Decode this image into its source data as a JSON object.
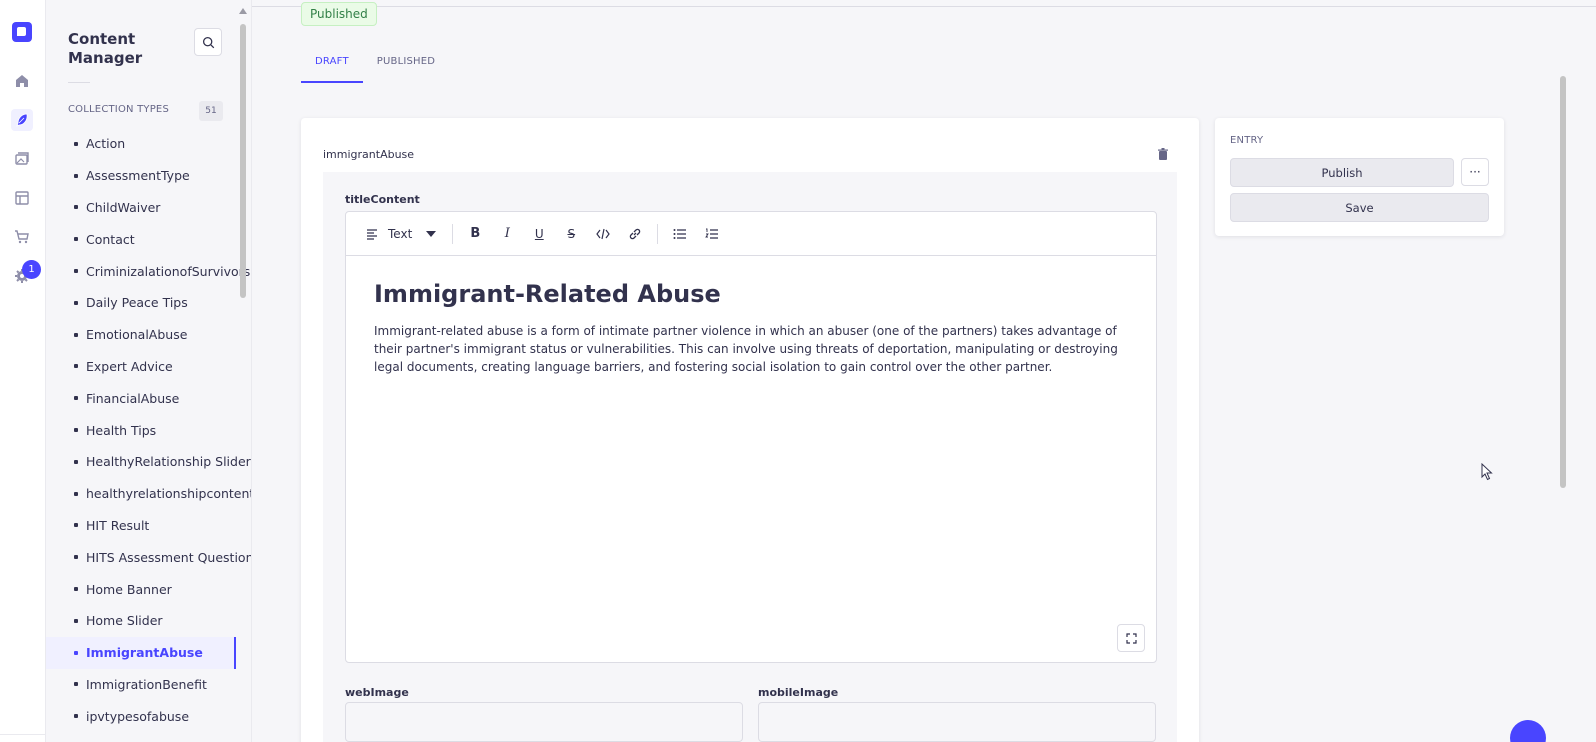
{
  "rail": {
    "notification_count": "1"
  },
  "subnav": {
    "title": "Content Manager",
    "section_title": "COLLECTION TYPES",
    "count": "51",
    "items": [
      {
        "label": "Action"
      },
      {
        "label": "AssessmentType"
      },
      {
        "label": "ChildWaiver"
      },
      {
        "label": "Contact"
      },
      {
        "label": "CriminizalationofSurvivors"
      },
      {
        "label": "Daily Peace Tips"
      },
      {
        "label": "EmotionalAbuse"
      },
      {
        "label": "Expert Advice"
      },
      {
        "label": "FinancialAbuse"
      },
      {
        "label": "Health Tips"
      },
      {
        "label": "HealthyRelationship Slider"
      },
      {
        "label": "healthyrelationshipcontent"
      },
      {
        "label": "HIT Result"
      },
      {
        "label": "HITS Assessment Question"
      },
      {
        "label": "Home Banner"
      },
      {
        "label": "Home Slider"
      },
      {
        "label": "ImmigrantAbuse",
        "active": true
      },
      {
        "label": "ImmigrationBenefit"
      },
      {
        "label": "ipvtypesofabuse"
      }
    ]
  },
  "header": {
    "status_badge": "Published",
    "tabs": [
      {
        "label": "DRAFT",
        "active": true
      },
      {
        "label": "PUBLISHED"
      }
    ]
  },
  "editor_card": {
    "component_name": "immigrantAbuse",
    "field_label": "titleContent",
    "toolbar": {
      "block_type": "Text"
    },
    "heading": "Immigrant-Related Abuse",
    "paragraph": "Immigrant-related abuse is a form of intimate partner violence in which an abuser (one of the partners) takes advantage of their partner's immigrant status or vulnerabilities. This can involve using threats of deportation, manipulating or destroying legal documents, creating language barriers, and fostering social isolation to gain control over the other partner.",
    "web_image_label": "webImage",
    "mobile_image_label": "mobileImage"
  },
  "entry": {
    "title": "ENTRY",
    "publish_label": "Publish",
    "save_label": "Save",
    "more_label": "···"
  },
  "colors": {
    "primary": "#4945ff",
    "success_text": "#328048",
    "success_bg": "#eafbe7"
  }
}
